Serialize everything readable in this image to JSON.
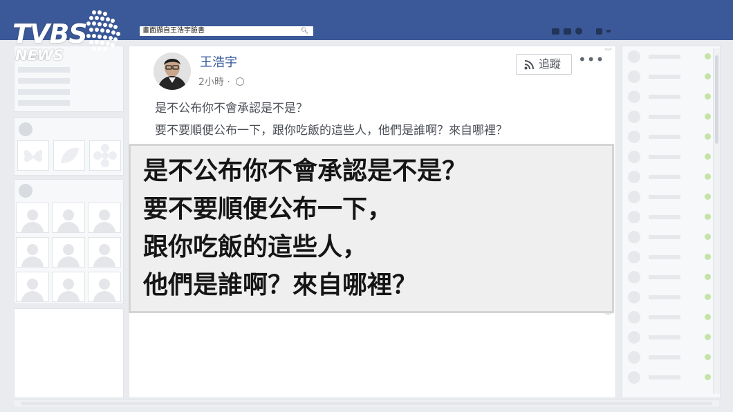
{
  "logo": {
    "brand": "TVBS",
    "sub": "NEWS"
  },
  "search": {
    "text": "畫面擷自王浩宇臉書",
    "icon": "search-icon"
  },
  "post": {
    "author": "王浩宇",
    "time": "2小時",
    "dot": "·",
    "privacy_icon": "globe-icon",
    "follow_label": "追蹤",
    "more_label": "•••",
    "line1": "是不公布你不會承認是不是？",
    "line2": "要不要順便公布一下，跟你吃飯的這些人，他們是誰啊？來自哪裡？"
  },
  "quote": {
    "lines": [
      "是不公布你不會承認是不是？",
      "要不要順便公布一下，",
      "跟你吃飯的這些人，",
      "他們是誰啊？來自哪裡？"
    ]
  },
  "colors": {
    "brand_blue": "#3b5998",
    "link_blue": "#365899",
    "online_green": "#c5e3a7"
  }
}
